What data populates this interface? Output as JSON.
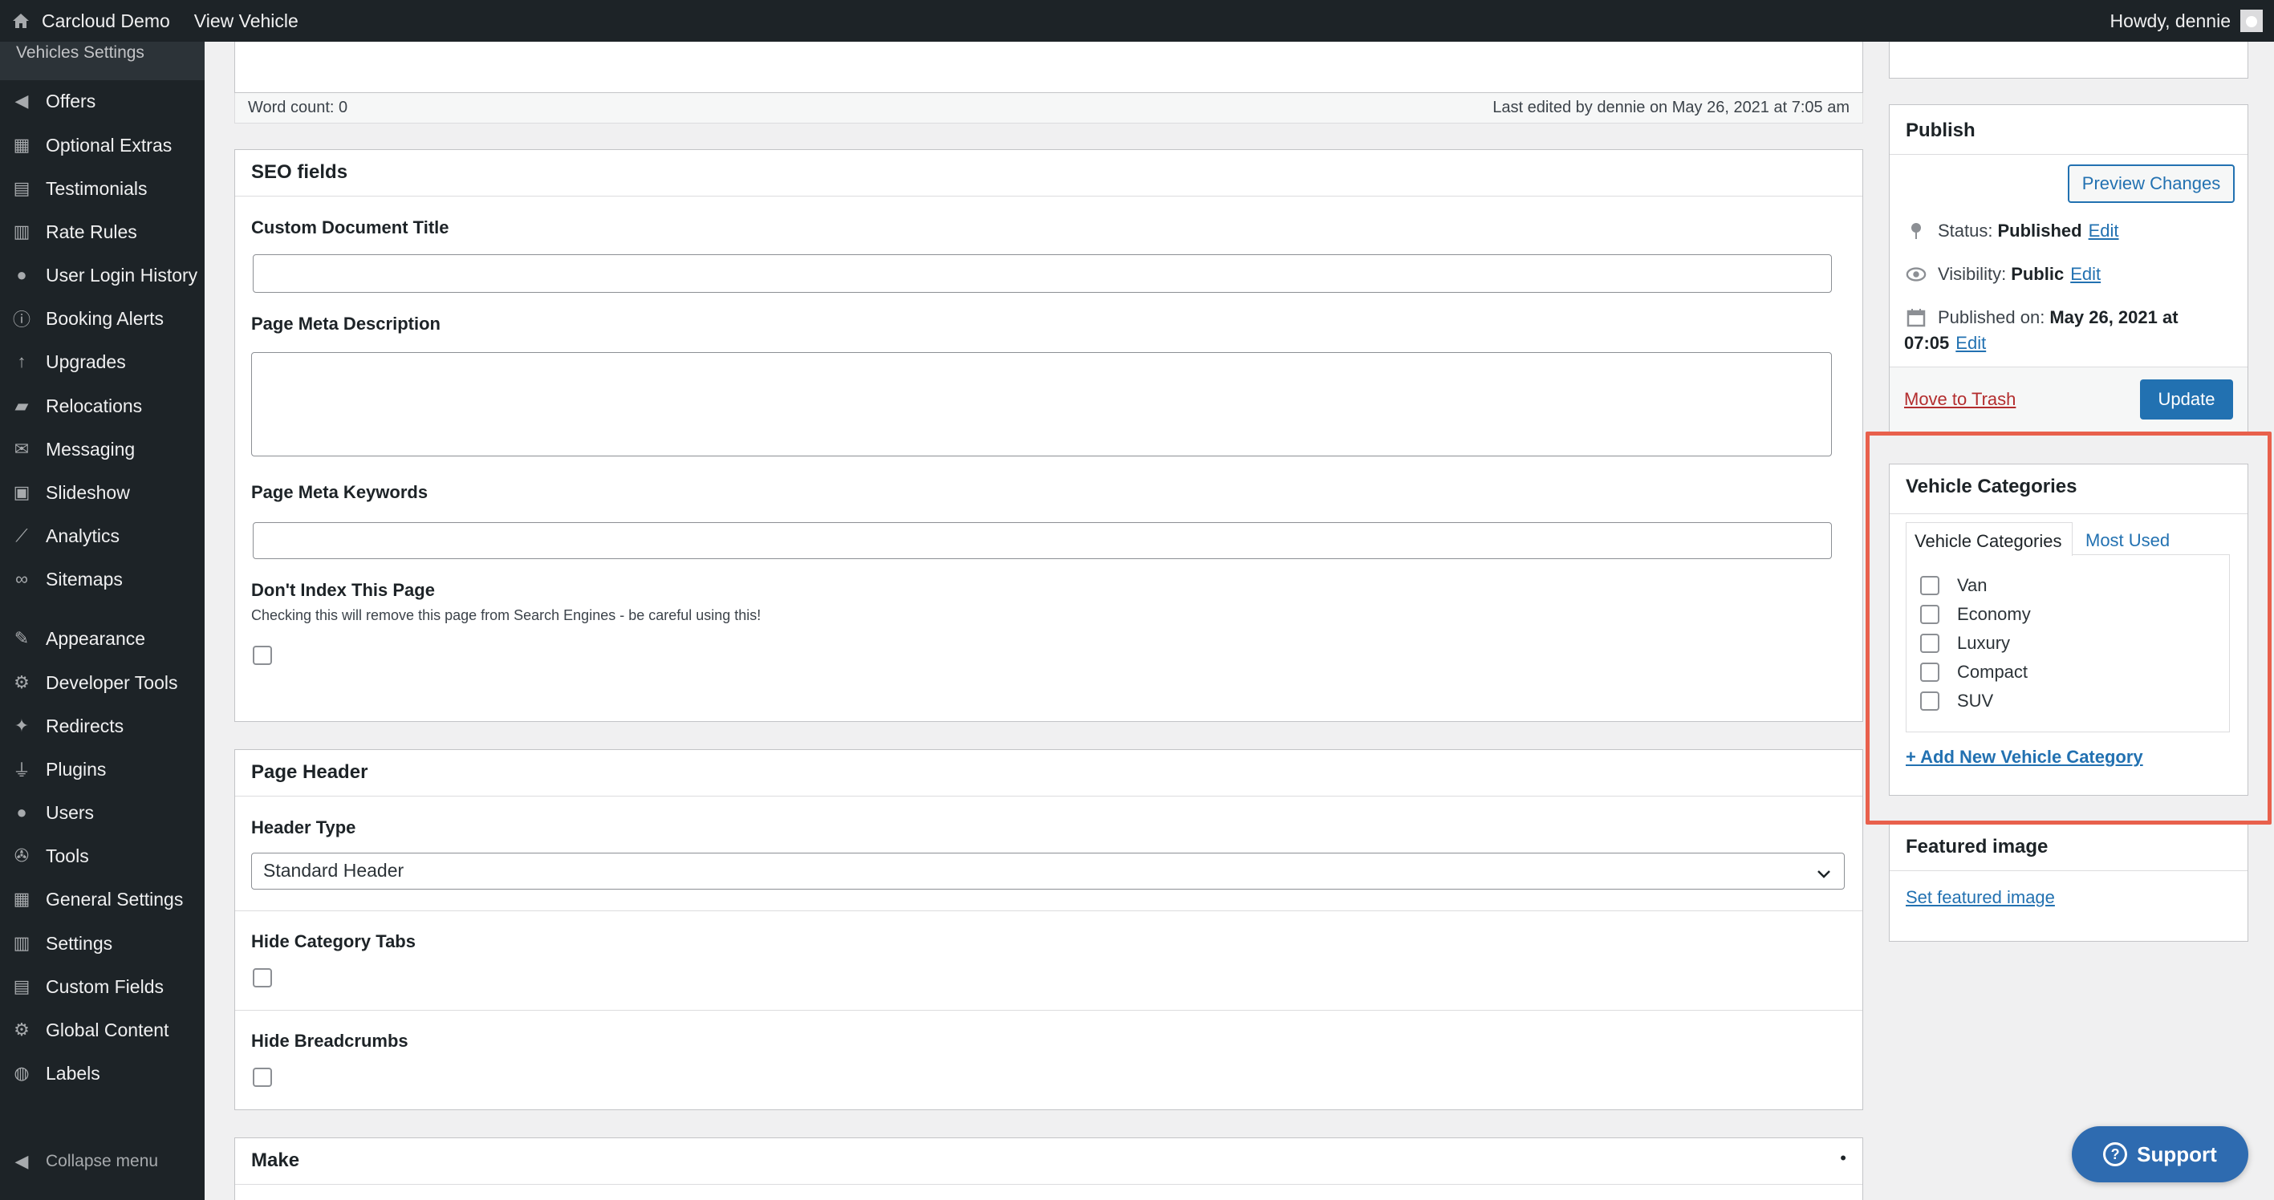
{
  "adminbar": {
    "site_name": "Carcloud Demo",
    "view_link": "View Vehicle",
    "greeting": "Howdy, dennie"
  },
  "sidebar": {
    "submenu_top": "Vehicles Settings",
    "items": [
      {
        "label": "Offers",
        "icon": "megaphone-icon"
      },
      {
        "label": "Optional Extras",
        "icon": "grid-icon"
      },
      {
        "label": "Testimonials",
        "icon": "comment-icon"
      },
      {
        "label": "Rate Rules",
        "icon": "clipboard-icon"
      },
      {
        "label": "User Login History",
        "icon": "clock-icon"
      },
      {
        "label": "Booking Alerts",
        "icon": "info-icon"
      },
      {
        "label": "Upgrades",
        "icon": "arrow-up-icon"
      },
      {
        "label": "Relocations",
        "icon": "truck-icon"
      },
      {
        "label": "Messaging",
        "icon": "envelope-icon"
      },
      {
        "label": "Slideshow",
        "icon": "slides-icon"
      },
      {
        "label": "Analytics",
        "icon": "chart-line-icon"
      },
      {
        "label": "Sitemaps",
        "icon": "link-icon"
      },
      {
        "label": "Appearance",
        "icon": "paintbrush-icon"
      },
      {
        "label": "Developer Tools",
        "icon": "gear-icon"
      },
      {
        "label": "Redirects",
        "icon": "pin-icon"
      },
      {
        "label": "Plugins",
        "icon": "plug-icon"
      },
      {
        "label": "Users",
        "icon": "user-icon"
      },
      {
        "label": "Tools",
        "icon": "wrench-icon"
      },
      {
        "label": "General Settings",
        "icon": "sliders-icon"
      },
      {
        "label": "Settings",
        "icon": "settings-icon"
      },
      {
        "label": "Custom Fields",
        "icon": "table-icon"
      },
      {
        "label": "Global Content",
        "icon": "cog-icon"
      },
      {
        "label": "Labels",
        "icon": "globe-icon"
      }
    ],
    "collapse": "Collapse menu"
  },
  "editor": {
    "word_count": "Word count: 0",
    "last_edited": "Last edited by dennie on May 26, 2021 at 7:05 am"
  },
  "seo": {
    "title": "SEO fields",
    "custom_title_label": "Custom Document Title",
    "custom_title_value": "",
    "meta_desc_label": "Page Meta Description",
    "meta_desc_value": "",
    "meta_keywords_label": "Page Meta Keywords",
    "meta_keywords_value": "",
    "noindex_label": "Don't Index This Page",
    "noindex_hint": "Checking this will remove this page from Search Engines - be careful using this!"
  },
  "page_header": {
    "title": "Page Header",
    "header_type_label": "Header Type",
    "header_type_value": "Standard Header",
    "hide_category_tabs_label": "Hide Category Tabs",
    "hide_breadcrumbs_label": "Hide Breadcrumbs"
  },
  "make": {
    "title": "Make",
    "toggle": "•"
  },
  "publish": {
    "title": "Publish",
    "preview_button": "Preview Changes",
    "status_label": "Status:",
    "status_value": "Published",
    "visibility_label": "Visibility:",
    "visibility_value": "Public",
    "published_on_label": "Published on:",
    "published_on_value": "May 26, 2021 at",
    "published_on_time": "07:05",
    "edit": "Edit",
    "trash": "Move to Trash",
    "update_button": "Update"
  },
  "vehicle_categories": {
    "title": "Vehicle Categories",
    "tab_all": "Vehicle Categories",
    "tab_most_used": "Most Used",
    "items": [
      "Van",
      "Economy",
      "Luxury",
      "Compact",
      "SUV"
    ],
    "add_new": "+ Add New Vehicle Category"
  },
  "featured_image": {
    "title": "Featured image",
    "set_link": "Set featured image"
  },
  "support": {
    "label": "Support"
  },
  "colors": {
    "accent": "#2271b1",
    "highlight": "#e8604c",
    "adminbar": "#1d2327"
  }
}
